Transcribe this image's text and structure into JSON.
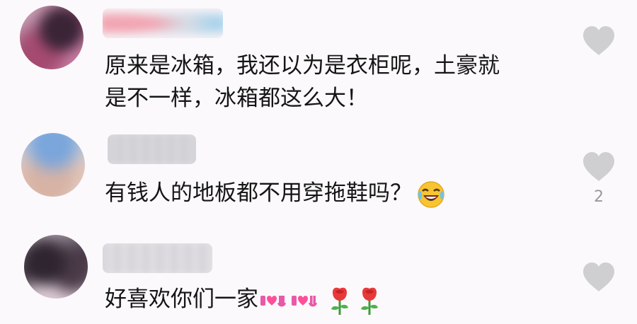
{
  "comments": [
    {
      "text": "原来是冰箱，我还以为是衣柜呢，土豪就\n是不一样，冰箱都这么大！",
      "like_count": ""
    },
    {
      "text": "有钱人的地板都不用穿拖鞋吗？",
      "like_count": "2",
      "emojis": [
        "laughing-crying-emoji"
      ]
    },
    {
      "text": "好喜欢你们一家",
      "like_count": "",
      "emojis": [
        "i-love-you-sticker",
        "i-love-you-sticker",
        "rose-emoji",
        "rose-emoji"
      ]
    }
  ],
  "colors": {
    "background": "#fbf9fc",
    "text": "#151515",
    "like_icon": "#cfcfd2",
    "like_count": "#9a9a9a"
  },
  "icons": {
    "like": "heart-icon"
  }
}
